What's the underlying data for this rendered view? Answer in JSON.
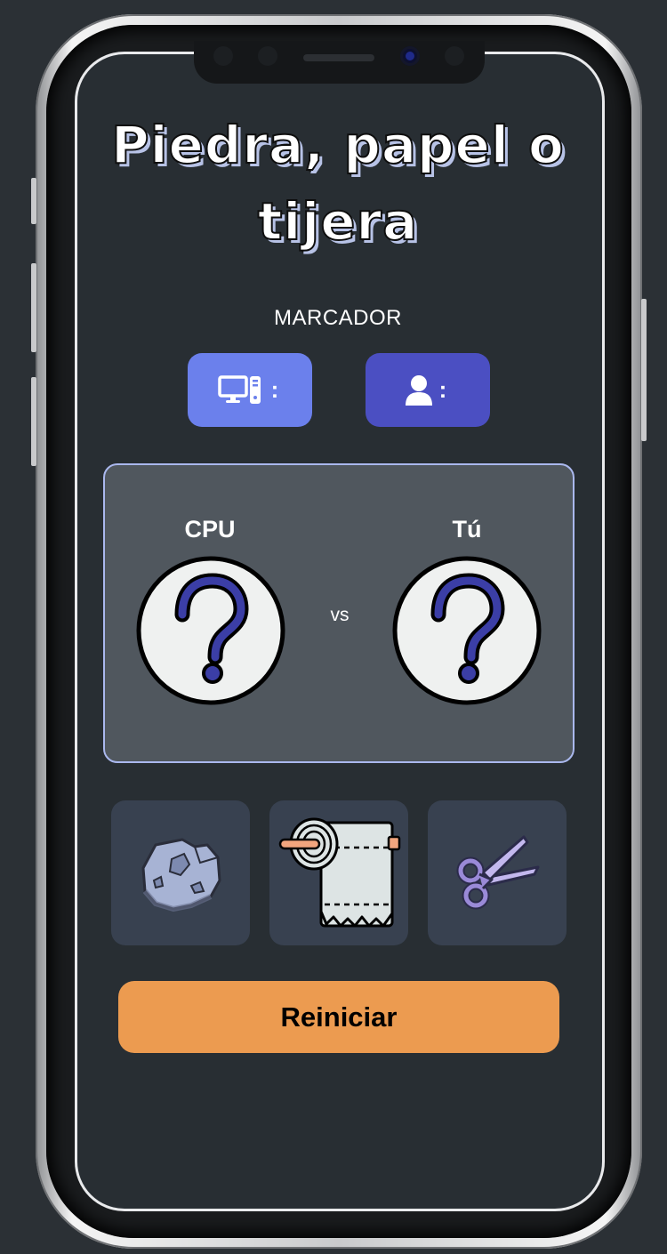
{
  "game": {
    "title": "Piedra, papel o tijera",
    "scoreboard_label": "MARCADOR",
    "cpu_score": {
      "icon": "computer-icon",
      "separator": ":",
      "value": "",
      "color": "#6b80ec"
    },
    "user_score": {
      "icon": "user-icon",
      "separator": ":",
      "value": "",
      "color": "#4b4fc2"
    },
    "cpu_label": "CPU",
    "user_label": "Tú",
    "versus": "vs",
    "cpu_choice_icon": "question-mark-icon",
    "user_choice_icon": "question-mark-icon",
    "choices": [
      {
        "name": "rock",
        "icon": "rock-icon"
      },
      {
        "name": "paper",
        "icon": "toilet-paper-icon"
      },
      {
        "name": "scissors",
        "icon": "scissors-icon"
      }
    ],
    "restart_label": "Reiniciar",
    "restart_color": "#ec9b50"
  }
}
